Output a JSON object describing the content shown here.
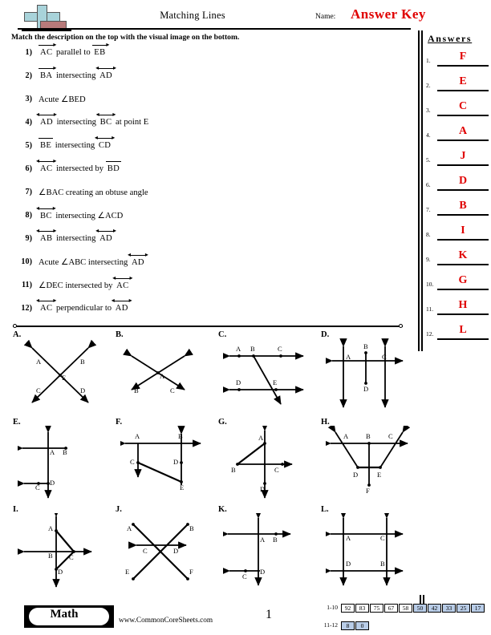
{
  "header": {
    "title": "Matching Lines",
    "name_label": "Name:",
    "answer_key": "Answer Key",
    "instructions": "Match the description on the top with the visual image on the bottom.",
    "logo_icon": "plus-minus-icon"
  },
  "questions": [
    {
      "num": "1)",
      "parts": [
        {
          "t": "ray",
          "txt": "AC"
        },
        {
          "t": "text",
          "txt": "parallel to"
        },
        {
          "t": "ray",
          "txt": "EB"
        }
      ]
    },
    {
      "num": "2)",
      "parts": [
        {
          "t": "ray",
          "txt": "BA"
        },
        {
          "t": "text",
          "txt": "intersecting"
        },
        {
          "t": "line",
          "txt": "AD"
        }
      ]
    },
    {
      "num": "3)",
      "parts": [
        {
          "t": "text",
          "txt": "Acute ∠BED"
        }
      ]
    },
    {
      "num": "4)",
      "parts": [
        {
          "t": "line",
          "txt": "AD"
        },
        {
          "t": "text",
          "txt": "intersecting"
        },
        {
          "t": "line",
          "txt": "BC"
        },
        {
          "t": "text",
          "txt": "at point E"
        }
      ]
    },
    {
      "num": "5)",
      "parts": [
        {
          "t": "seg",
          "txt": "BE"
        },
        {
          "t": "text",
          "txt": "intersecting"
        },
        {
          "t": "line",
          "txt": "CD"
        }
      ]
    },
    {
      "num": "6)",
      "parts": [
        {
          "t": "line",
          "txt": "AC"
        },
        {
          "t": "text",
          "txt": "intersected by"
        },
        {
          "t": "seg",
          "txt": "BD"
        }
      ]
    },
    {
      "num": "7)",
      "parts": [
        {
          "t": "text",
          "txt": "∠BAC  creating an obtuse angle"
        }
      ]
    },
    {
      "num": "8)",
      "parts": [
        {
          "t": "line",
          "txt": "BC"
        },
        {
          "t": "text",
          "txt": "intersecting ∠ACD"
        }
      ]
    },
    {
      "num": "9)",
      "parts": [
        {
          "t": "line",
          "txt": "AB"
        },
        {
          "t": "text",
          "txt": "intersecting"
        },
        {
          "t": "line",
          "txt": "AD"
        }
      ]
    },
    {
      "num": "10)",
      "parts": [
        {
          "t": "text",
          "txt": "Acute ∠ABC  intersecting"
        },
        {
          "t": "line",
          "txt": "AD"
        }
      ]
    },
    {
      "num": "11)",
      "parts": [
        {
          "t": "text",
          "txt": "∠DEC  intersected by"
        },
        {
          "t": "line",
          "txt": "AC"
        }
      ]
    },
    {
      "num": "12)",
      "parts": [
        {
          "t": "line",
          "txt": "AC"
        },
        {
          "t": "text",
          "txt": "perpendicular to"
        },
        {
          "t": "line",
          "txt": "AD"
        }
      ]
    }
  ],
  "answers": {
    "heading": "Answers",
    "items": [
      {
        "index": "1.",
        "value": "F"
      },
      {
        "index": "2.",
        "value": "E"
      },
      {
        "index": "3.",
        "value": "C"
      },
      {
        "index": "4.",
        "value": "A"
      },
      {
        "index": "5.",
        "value": "J"
      },
      {
        "index": "6.",
        "value": "D"
      },
      {
        "index": "7.",
        "value": "B"
      },
      {
        "index": "8.",
        "value": "I"
      },
      {
        "index": "9.",
        "value": "K"
      },
      {
        "index": "10.",
        "value": "G"
      },
      {
        "index": "11.",
        "value": "H"
      },
      {
        "index": "12.",
        "value": "L"
      }
    ],
    "answer_color": "#e00000"
  },
  "diagrams": [
    {
      "label": "A.",
      "points": [
        "A",
        "B",
        "C",
        "D",
        "E"
      ],
      "description": "two lines crossing in an X at point E, arrow ends labeled A upper-left, B upper-right, C lower-left, D lower-right"
    },
    {
      "label": "B.",
      "points": [
        "A",
        "B",
        "C"
      ],
      "description": "two lines crossing at A, lower-left end labeled B, lower-right end labeled C"
    },
    {
      "label": "C.",
      "points": [
        "A",
        "B",
        "C",
        "D",
        "E"
      ],
      "description": "two parallel horizontal lines with points A B C on top and D E on bottom, a transversal from B through E"
    },
    {
      "label": "D.",
      "points": [
        "A",
        "B",
        "C",
        "D"
      ],
      "description": "two vertical lines A and C crossed by a horizontal line, vertical segment from B down to D"
    },
    {
      "label": "E.",
      "points": [
        "A",
        "B",
        "C",
        "D"
      ],
      "description": "vertical line through A and D, horizontal ray left from B through A, horizontal ray left from D through C"
    },
    {
      "label": "F.",
      "points": [
        "A",
        "B",
        "C",
        "D",
        "E"
      ],
      "description": "horizontal line through A and B, two vertical lines down through C and D, slanted segment from C to E"
    },
    {
      "label": "G.",
      "points": [
        "A",
        "B",
        "C",
        "D"
      ],
      "description": "vertical line through A and D crossed by horizontal ray to C, triangle from B up to A and across to C"
    },
    {
      "label": "H.",
      "points": [
        "A",
        "B",
        "C",
        "D",
        "E",
        "F"
      ],
      "description": "trapezoid with A B C on top line and D E on bottom, vertical line through B down to F"
    },
    {
      "label": "I.",
      "points": [
        "A",
        "B",
        "C",
        "D"
      ],
      "description": "vertical and horizontal lines crossing at B, triangle A C D to the right"
    },
    {
      "label": "J.",
      "points": [
        "A",
        "B",
        "C",
        "D",
        "E",
        "F"
      ],
      "description": "two crossing segments A-F and B-E with a horizontal line through C and D"
    },
    {
      "label": "K.",
      "points": [
        "A",
        "B",
        "C",
        "D"
      ],
      "description": "vertical line, horizontal line through A with B to the right, horizontal ray left at D through C"
    },
    {
      "label": "L.",
      "points": [
        "A",
        "B",
        "C",
        "D"
      ],
      "description": "two vertical and two horizontal lines forming a square with corners A C D B"
    }
  ],
  "footer": {
    "brand": "Math",
    "website": "www.CommonCoreSheets.com",
    "page_number": "1",
    "score_table": {
      "rows": [
        {
          "label": "1-10",
          "values": [
            "92",
            "83",
            "75",
            "67",
            "58",
            "50",
            "42",
            "33",
            "25",
            "17"
          ],
          "highlight": [
            false,
            false,
            false,
            false,
            false,
            true,
            true,
            true,
            true,
            true
          ]
        },
        {
          "label": "11-12",
          "values": [
            "8",
            "0"
          ],
          "highlight": [
            true,
            true
          ]
        }
      ],
      "highlight_color": "#b9cde8"
    }
  }
}
